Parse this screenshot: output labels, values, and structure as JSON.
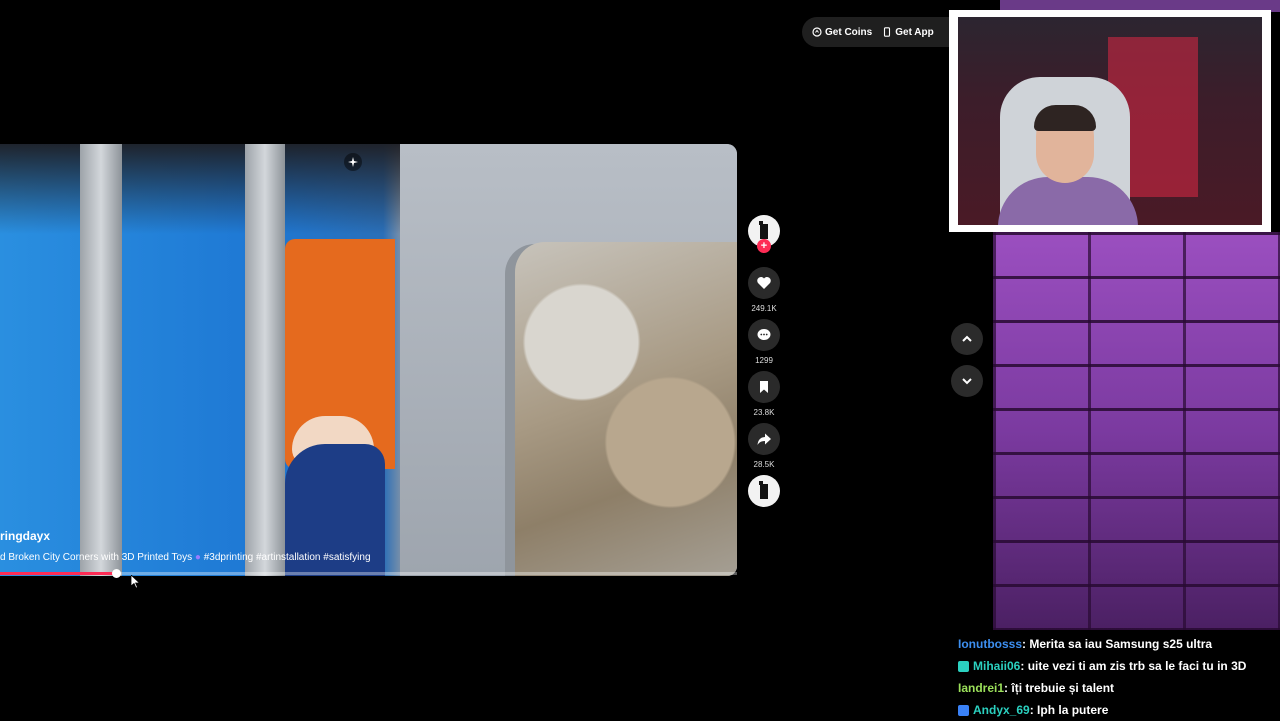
{
  "topbar": {
    "get_coins": "Get Coins",
    "get_app": "Get App"
  },
  "video": {
    "creator": "ringdayx",
    "caption_prefix": "d Broken City Corners with 3D Printed Toys ",
    "caption_tags": "#3dprinting #artinstallation #satisfying",
    "progress": 0.157,
    "colors": {
      "progress": "#fe2c55",
      "accent_pink": "#fe2c55"
    }
  },
  "actions": {
    "likes": "249.1K",
    "comments": "1299",
    "saves": "23.8K",
    "shares": "28.5K",
    "icons": [
      "heart-icon",
      "comment-icon",
      "bookmark-icon",
      "share-icon"
    ]
  },
  "chat": {
    "messages": [
      {
        "user": "Ionutbosss",
        "text": ": Merita sa iau Samsung s25 ultra",
        "color": "#3d8ff0",
        "badge": ""
      },
      {
        "user": "Mihaii06",
        "text": ": uite vezi ti am zis trb sa le faci tu in 3D",
        "color": "#2bd1c0",
        "badge": "badge-icon"
      },
      {
        "user": "Iandrei1",
        "text": ": îți trebuie și talent",
        "color": "#9be05a",
        "badge": ""
      },
      {
        "user": "Andyx_69",
        "text": ": Iph la putere",
        "color": "#2bd1c0",
        "badge": "prime-icon"
      }
    ]
  }
}
